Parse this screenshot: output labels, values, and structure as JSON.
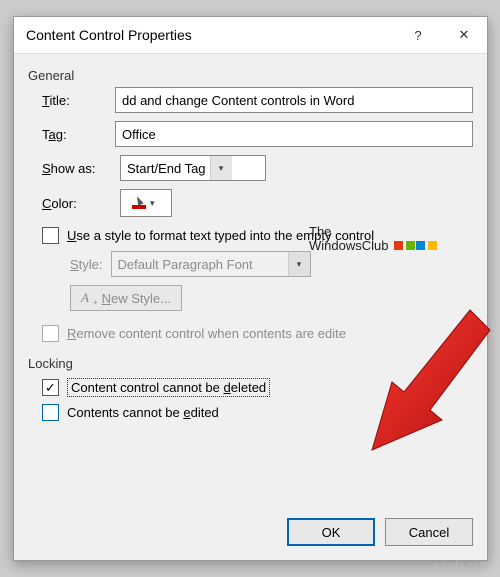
{
  "titlebar": {
    "title": "Content Control Properties",
    "help_glyph": "?",
    "close_glyph": "✕"
  },
  "general": {
    "label": "General",
    "title_label_pre": "T",
    "title_label_post": "itle:",
    "title_value": "dd and change Content controls in Word",
    "tag_label_pre": "T",
    "tag_label_u": "a",
    "tag_label_post": "g:",
    "tag_value": "Office",
    "showas_label_pre": "",
    "showas_label_u": "S",
    "showas_label_post": "how as:",
    "showas_value": "Start/End Tag",
    "color_label_u": "C",
    "color_label_post": "olor:"
  },
  "style": {
    "use_label_u": "U",
    "use_label_post": "se a style to format text typed into the empty control",
    "style_label_u": "S",
    "style_label_post": "tyle:",
    "style_value": "Default Paragraph Font",
    "newstyle_u": "N",
    "newstyle_post": "ew Style..."
  },
  "remove": {
    "label_u": "R",
    "label_post": "emove content control when contents are edite"
  },
  "locking": {
    "label": "Locking",
    "cannot_delete_pre": "Content control cannot be ",
    "cannot_delete_u": "d",
    "cannot_delete_post": "eleted",
    "cannot_edit_pre": "Contents cannot be ",
    "cannot_edit_u": "e",
    "cannot_edit_post": "dited"
  },
  "buttons": {
    "ok": "OK",
    "cancel": "Cancel"
  },
  "watermark": "wsxdn.com",
  "logo": {
    "line1": "The",
    "line2": "WindowsClub"
  }
}
